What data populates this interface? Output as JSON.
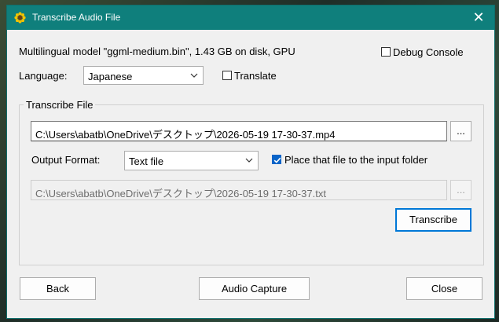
{
  "window": {
    "title": "Transcribe Audio File",
    "close_glyph": "✕",
    "icon": "sunflower-icon"
  },
  "model_info": "Multilingual model \"ggml-medium.bin\", 1.43 GB on disk, GPU",
  "debug_console": {
    "label": "Debug Console",
    "checked": false
  },
  "language": {
    "label": "Language:",
    "selected": "Japanese"
  },
  "translate": {
    "label": "Translate",
    "checked": false
  },
  "transcribe_group": {
    "title": "Transcribe File",
    "input_path": "C:\\Users\\abatb\\OneDrive\\デスクトップ\\2026-05-19 17-30-37.mp4",
    "browse_input_label": "...",
    "output_format": {
      "label": "Output Format:",
      "selected": "Text file"
    },
    "place_in_input_folder": {
      "label": "Place that file to the input folder",
      "checked": true
    },
    "output_path": "C:\\Users\\abatb\\OneDrive\\デスクトップ\\2026-05-19 17-30-37.txt",
    "browse_output_label": "...",
    "transcribe_label": "Transcribe"
  },
  "footer": {
    "back_label": "Back",
    "audio_capture_label": "Audio Capture",
    "close_label": "Close"
  },
  "colors": {
    "titlebar": "#0f7f7c",
    "accent": "#0078d7",
    "checkbox_checked": "#0a64c8"
  }
}
